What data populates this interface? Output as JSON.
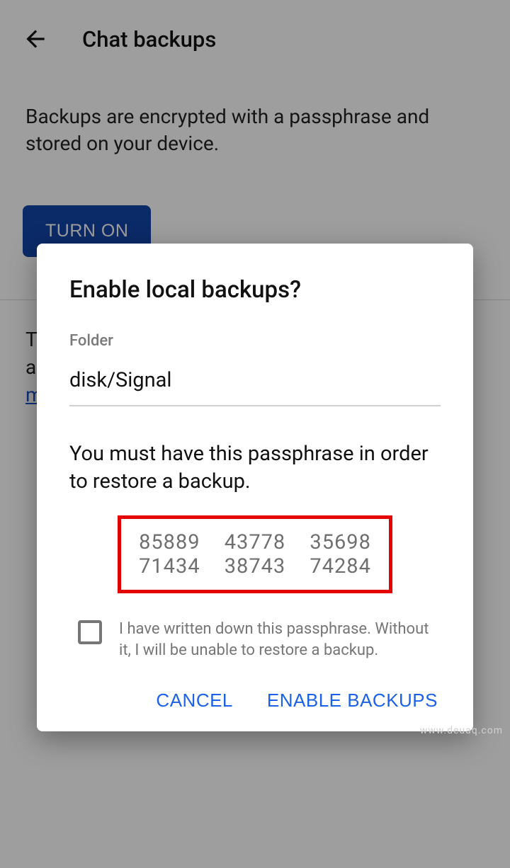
{
  "header": {
    "title": "Chat backups"
  },
  "description": "Backups are encrypted with a passphrase and stored on your device.",
  "turn_on_label": "TURN ON",
  "bg": {
    "line1_prefix": "To",
    "line2_prefix": "ap",
    "link_prefix": "m"
  },
  "dialog": {
    "title": "Enable local backups?",
    "folder_label": "Folder",
    "folder_path": "disk/Signal",
    "passphrase_text": "You must have this passphrase in order to restore a backup.",
    "passphrase": {
      "g1": "85889",
      "g2": "43778",
      "g3": "35698",
      "g4": "71434",
      "g5": "38743",
      "g6": "74284"
    },
    "ack_text": "I have written down this passphrase. Without it, I will be unable to restore a backup.",
    "cancel": "CANCEL",
    "enable": "ENABLE BACKUPS"
  },
  "watermark": "www.deuaq.com"
}
